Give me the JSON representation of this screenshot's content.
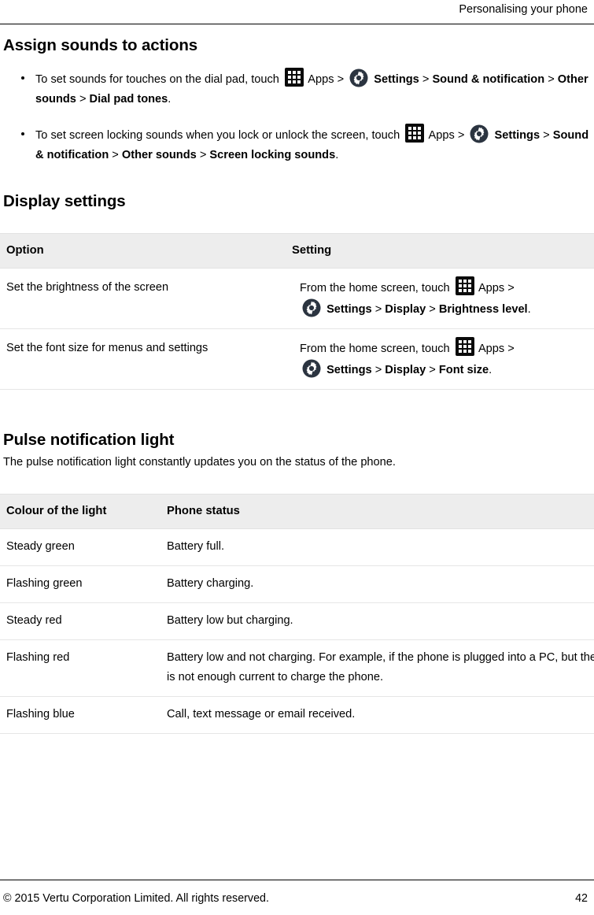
{
  "header": {
    "running_title": "Personalising your phone"
  },
  "sections": {
    "assign_sounds": {
      "title": "Assign sounds to actions",
      "bullets": [
        {
          "lead": "To set sounds for touches on the dial pad, touch",
          "apps_label": "Apps",
          "settings_label": "Settings",
          "path": [
            "Sound & notification",
            "Other sounds",
            "Dial pad tones"
          ],
          "terminator": "."
        },
        {
          "lead": "To set screen locking sounds when you lock or unlock the screen, touch",
          "apps_label": "Apps",
          "settings_label": "Settings",
          "path": [
            "Sound & notification",
            "Other sounds",
            "Screen locking sounds"
          ],
          "terminator": "."
        }
      ]
    },
    "display_settings": {
      "title": "Display settings",
      "table": {
        "columns": [
          "Option",
          "Setting"
        ],
        "rows": [
          {
            "option": "Set the brightness of the screen",
            "lead": "From the home screen, touch",
            "apps_label": "Apps",
            "settings_label": "Settings",
            "path": [
              "Display",
              "Brightness level"
            ],
            "terminator": "."
          },
          {
            "option": "Set the font size for menus and settings",
            "lead": "From the home screen, touch",
            "apps_label": "Apps",
            "settings_label": "Settings",
            "path": [
              "Display",
              "Font size"
            ],
            "terminator": "."
          }
        ]
      }
    },
    "pulse_light": {
      "title": "Pulse notification light",
      "intro": "The pulse notification light constantly updates you on the status of the phone.",
      "table": {
        "columns": [
          "Colour of the light",
          "Phone status"
        ],
        "rows": [
          {
            "colour": "Steady green",
            "status": "Battery full."
          },
          {
            "colour": "Flashing green",
            "status": "Battery charging."
          },
          {
            "colour": "Steady red",
            "status": "Battery low but charging."
          },
          {
            "colour": "Flashing red",
            "status": "Battery low and not charging. For example, if the phone is plugged into a PC, but there is not enough current to charge the phone."
          },
          {
            "colour": "Flashing blue",
            "status": "Call, text message or email received."
          }
        ]
      }
    }
  },
  "footer": {
    "copyright": "© 2015 Vertu Corporation Limited. All rights reserved.",
    "page_number": "42"
  },
  "icons": {
    "apps": "apps-grid-icon",
    "settings": "gear-icon"
  },
  "colors": {
    "table_header_bg": "#ededed",
    "rule": "#000000",
    "row_border": "#e6e6e6",
    "settings_icon": "#2b3440",
    "apps_icon": "#0a0a0a"
  },
  "separator": ">"
}
